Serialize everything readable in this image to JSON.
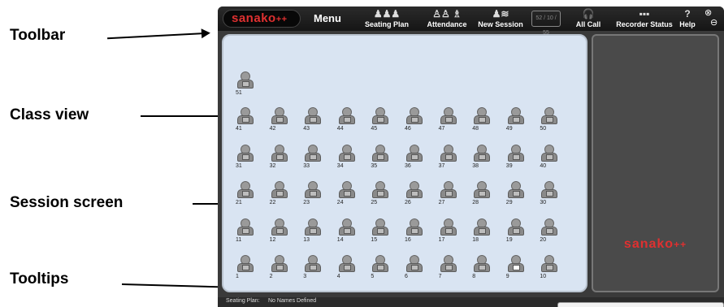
{
  "callouts": {
    "toolbar": "Toolbar",
    "class_view": "Class view",
    "session_screen": "Session screen",
    "tooltips": "Tooltips"
  },
  "toolbar": {
    "brand": "sanako",
    "brand_suffix": "++",
    "menu": "Menu",
    "items": [
      {
        "label": "Seating Plan",
        "icon": "seating-plan-icon"
      },
      {
        "label": "Attendance",
        "icon": "attendance-icon"
      },
      {
        "label": "New Session",
        "icon": "new-session-icon"
      },
      {
        "label": "All Call",
        "icon": "all-call-icon"
      },
      {
        "label": "Recorder Status",
        "icon": "recorder-status-icon"
      },
      {
        "label": "Help",
        "icon": "help-icon"
      }
    ],
    "disabled_button": "52 / 10 / 55"
  },
  "class_view": {
    "extra_seat": "51",
    "rows": [
      [
        "41",
        "42",
        "43",
        "44",
        "45",
        "46",
        "47",
        "48",
        "49",
        "50"
      ],
      [
        "31",
        "32",
        "33",
        "34",
        "35",
        "36",
        "37",
        "38",
        "39",
        "40"
      ],
      [
        "21",
        "22",
        "23",
        "24",
        "25",
        "26",
        "27",
        "28",
        "29",
        "30"
      ],
      [
        "11",
        "12",
        "13",
        "14",
        "15",
        "16",
        "17",
        "18",
        "19",
        "20"
      ],
      [
        "1",
        "2",
        "3",
        "4",
        "5",
        "6",
        "7",
        "8",
        "9",
        "10"
      ]
    ],
    "active_seat": "9"
  },
  "session_screen": {
    "brand": "sanako",
    "brand_suffix": "++"
  },
  "status_bar": {
    "seating_label": "Seating Plan:",
    "seating_value": "No Names Defined"
  },
  "colors": {
    "brand_red": "#e03030",
    "class_bg": "#d9e4f2",
    "session_bg": "#4a4a4a",
    "toolbar_bg": "#1e1e1e"
  }
}
